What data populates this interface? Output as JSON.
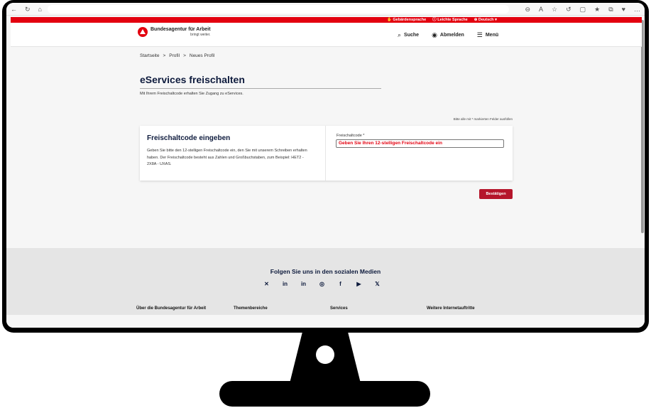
{
  "browser": {
    "nav_icons": [
      "←",
      "↻",
      "⌂"
    ],
    "right_icons": [
      "⊖",
      "A",
      "☆",
      "↺",
      "▢",
      "★",
      "⧉",
      "♥",
      "…"
    ]
  },
  "utility_bar": {
    "sign_language": "Gebärdensprache",
    "easy_language": "Leichte Sprache",
    "language": "Deutsch"
  },
  "header": {
    "logo_text": "Bundesagentur für Arbeit",
    "logo_sub": "bringt weiter.",
    "search": "Suche",
    "logout": "Abmelden",
    "menu": "Menü"
  },
  "breadcrumb": {
    "home": "Startseite",
    "profile": "Profil",
    "new_profile": "Neues Profil",
    "sep": ">"
  },
  "page": {
    "title": "eServices freischalten",
    "intro": "Mit Ihrem Freischaltcode erhalten Sie Zugang zu eServices.",
    "required_note": "Bitte alle mit * markierten Felder ausfüllen"
  },
  "card": {
    "title": "Freischaltcode eingeben",
    "body": "Geben Sie bitte den 12-stelligen Freischaltcode ein, den Sie mit unserem Schreiben erhalten haben. Der Freischaltcode besteht aus Zahlen und Großbuchstaben, zum Beispiel: HET2 - 2X8A - UXAS.",
    "field_label": "Freischaltcode *",
    "field_value": "Geben Sie Ihren 12-stelligen Freischaltcode ein",
    "confirm_button": "Bestätigen"
  },
  "footer": {
    "social_title": "Folgen Sie uns in den sozialen Medien",
    "social_icons": [
      "✕",
      "in",
      "in",
      "◎",
      "f",
      "▶",
      "𝕏"
    ],
    "columns": [
      "Über die Bundesagentur für Arbeit",
      "Themenbereiche",
      "Services",
      "Weitere Internetauftritte"
    ]
  },
  "colors": {
    "brand_red": "#e3000f",
    "button_red": "#b5152b",
    "heading_navy": "#0e1b3d"
  }
}
